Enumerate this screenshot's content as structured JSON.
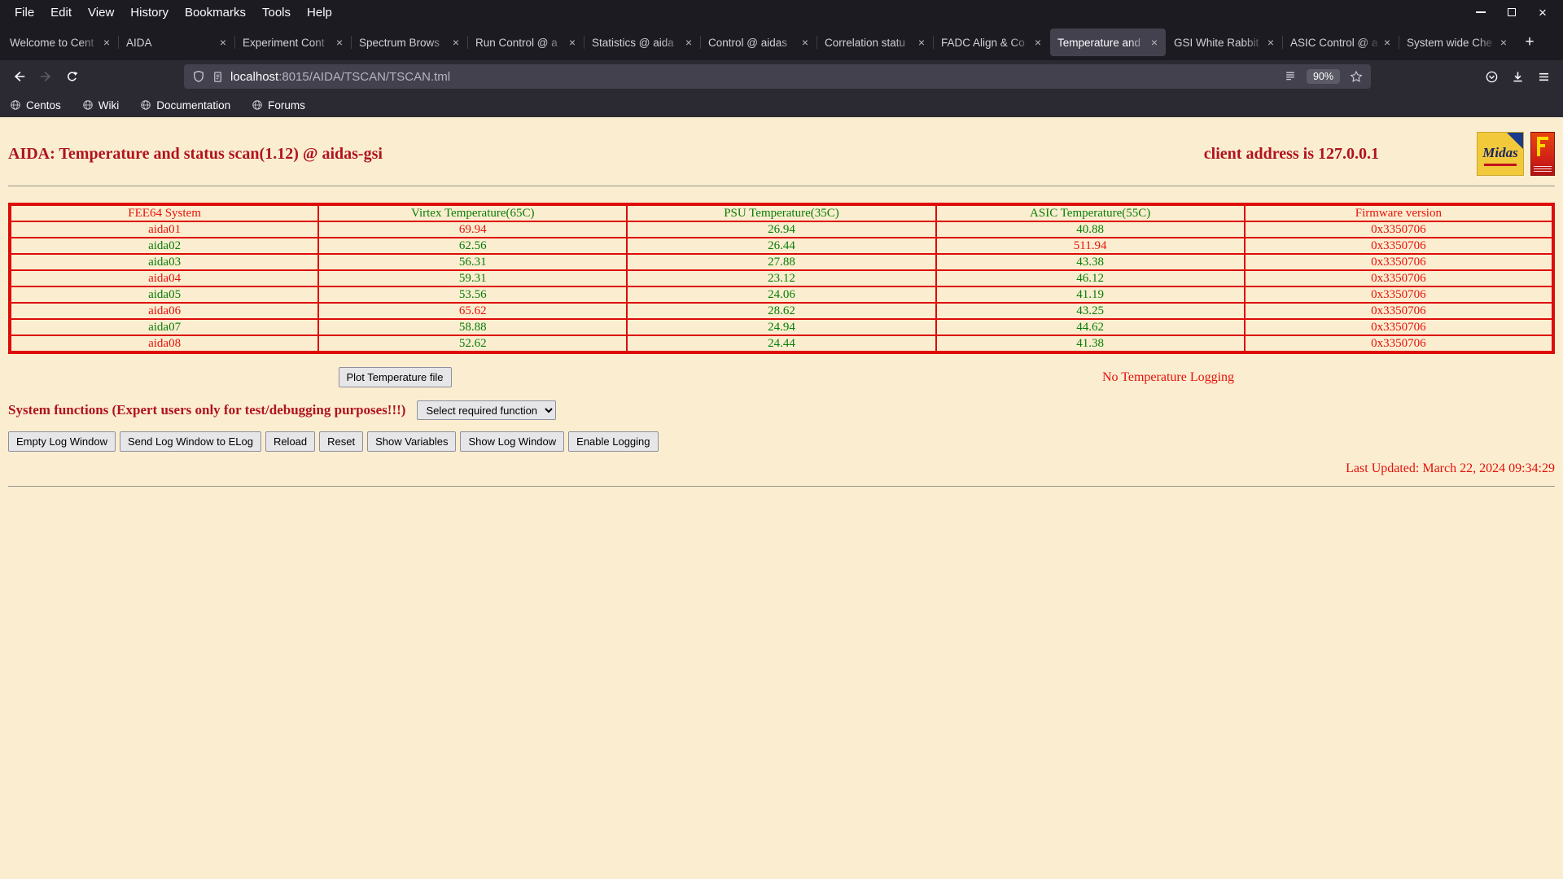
{
  "browser": {
    "menu": [
      "File",
      "Edit",
      "View",
      "History",
      "Bookmarks",
      "Tools",
      "Help"
    ],
    "tabs": [
      {
        "label": "Welcome to Cent",
        "active": false
      },
      {
        "label": "AIDA",
        "active": false
      },
      {
        "label": "Experiment Cont",
        "active": false
      },
      {
        "label": "Spectrum Brows",
        "active": false
      },
      {
        "label": "Run Control @ a",
        "active": false
      },
      {
        "label": "Statistics @ aida",
        "active": false
      },
      {
        "label": "Control @ aidas",
        "active": false
      },
      {
        "label": "Correlation statu",
        "active": false
      },
      {
        "label": "FADC Align & Co",
        "active": false
      },
      {
        "label": "Temperature and",
        "active": true
      },
      {
        "label": "GSI White Rabbit",
        "active": false
      },
      {
        "label": "ASIC Control @ a",
        "active": false
      },
      {
        "label": "System wide Che",
        "active": false
      }
    ],
    "glyphs": {
      "tab_close": "×",
      "new_tab": "+",
      "window_close": "×"
    },
    "url": {
      "host": "localhost",
      "path": ":8015/AIDA/TSCAN/TSCAN.tml"
    },
    "zoom": "90%",
    "bookmarks": [
      {
        "label": "Centos"
      },
      {
        "label": "Wiki"
      },
      {
        "label": "Documentation"
      },
      {
        "label": "Forums"
      }
    ]
  },
  "page": {
    "title": "AIDA: Temperature and status scan(1.12) @ aidas-gsi",
    "client_address": "client address is 127.0.0.1",
    "midas_logo_text": "Midas",
    "table": {
      "headers": [
        {
          "label": "FEE64 System",
          "color": "red"
        },
        {
          "label": "Virtex Temperature(65C)",
          "color": "green"
        },
        {
          "label": "PSU Temperature(35C)",
          "color": "green"
        },
        {
          "label": "ASIC Temperature(55C)",
          "color": "green"
        },
        {
          "label": "Firmware version",
          "color": "red"
        }
      ],
      "rows": [
        {
          "cells": [
            {
              "text": "aida01",
              "color": "red"
            },
            {
              "text": "69.94",
              "color": "red"
            },
            {
              "text": "26.94",
              "color": "green"
            },
            {
              "text": "40.88",
              "color": "green"
            },
            {
              "text": "0x3350706",
              "color": "red"
            }
          ]
        },
        {
          "cells": [
            {
              "text": "aida02",
              "color": "green"
            },
            {
              "text": "62.56",
              "color": "green"
            },
            {
              "text": "26.44",
              "color": "green"
            },
            {
              "text": "511.94",
              "color": "red"
            },
            {
              "text": "0x3350706",
              "color": "red"
            }
          ]
        },
        {
          "cells": [
            {
              "text": "aida03",
              "color": "green"
            },
            {
              "text": "56.31",
              "color": "green"
            },
            {
              "text": "27.88",
              "color": "green"
            },
            {
              "text": "43.38",
              "color": "green"
            },
            {
              "text": "0x3350706",
              "color": "red"
            }
          ]
        },
        {
          "cells": [
            {
              "text": "aida04",
              "color": "red"
            },
            {
              "text": "59.31",
              "color": "green"
            },
            {
              "text": "23.12",
              "color": "green"
            },
            {
              "text": "46.12",
              "color": "green"
            },
            {
              "text": "0x3350706",
              "color": "red"
            }
          ]
        },
        {
          "cells": [
            {
              "text": "aida05",
              "color": "green"
            },
            {
              "text": "53.56",
              "color": "green"
            },
            {
              "text": "24.06",
              "color": "green"
            },
            {
              "text": "41.19",
              "color": "green"
            },
            {
              "text": "0x3350706",
              "color": "red"
            }
          ]
        },
        {
          "cells": [
            {
              "text": "aida06",
              "color": "red"
            },
            {
              "text": "65.62",
              "color": "red"
            },
            {
              "text": "28.62",
              "color": "green"
            },
            {
              "text": "43.25",
              "color": "green"
            },
            {
              "text": "0x3350706",
              "color": "red"
            }
          ]
        },
        {
          "cells": [
            {
              "text": "aida07",
              "color": "green"
            },
            {
              "text": "58.88",
              "color": "green"
            },
            {
              "text": "24.94",
              "color": "green"
            },
            {
              "text": "44.62",
              "color": "green"
            },
            {
              "text": "0x3350706",
              "color": "red"
            }
          ]
        },
        {
          "cells": [
            {
              "text": "aida08",
              "color": "red"
            },
            {
              "text": "52.62",
              "color": "green"
            },
            {
              "text": "24.44",
              "color": "green"
            },
            {
              "text": "41.38",
              "color": "green"
            },
            {
              "text": "0x3350706",
              "color": "red"
            }
          ]
        }
      ]
    },
    "plot_button_label": "Plot Temperature file",
    "logging_status": "No Temperature Logging",
    "system_functions_label": "System functions (Expert users only for test/debugging purposes!!!)",
    "function_select_value": "Select required function",
    "action_buttons": [
      "Empty Log Window",
      "Send Log Window to ELog",
      "Reload",
      "Reset",
      "Show Variables",
      "Show Log Window",
      "Enable Logging"
    ],
    "last_updated": "Last Updated: March 22, 2024 09:34:29"
  },
  "colors": {
    "chrome_bg": "#1c1b22",
    "toolbar_bg": "#2b2a33",
    "active_tab_bg": "#42414d",
    "chrome_text": "#fbfbfe",
    "page_bg": "#fbeed0",
    "heading_red": "#b0131f",
    "bright_red": "#e8100c",
    "green": "#077d07",
    "table_border": "#de0b0b"
  }
}
